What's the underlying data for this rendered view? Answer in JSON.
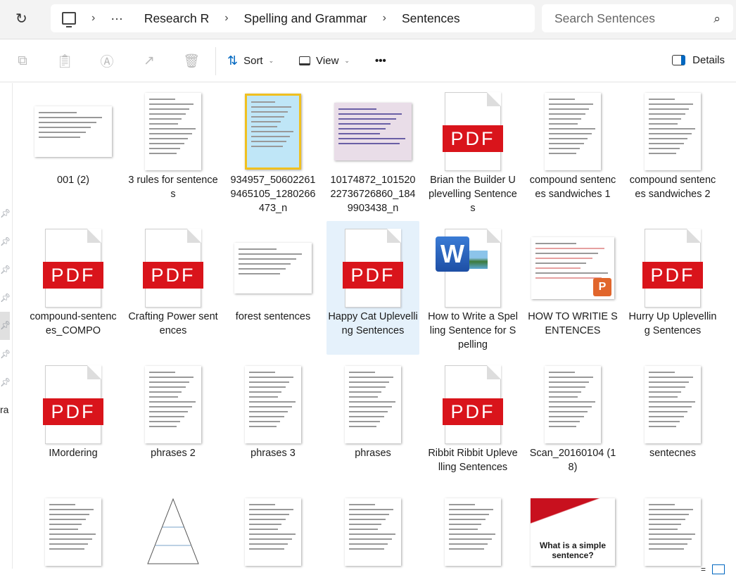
{
  "address": {
    "breadcrumb": [
      "Research R",
      "Spelling and Grammar",
      "Sentences"
    ],
    "search_placeholder": "Search Sentences"
  },
  "toolbar": {
    "sort": "Sort",
    "view": "View",
    "more": "•••",
    "details": "Details"
  },
  "sidebar": {
    "partial_label": "ra"
  },
  "items": [
    {
      "name": "001 (2)",
      "kind": "landscape"
    },
    {
      "name": "3 rules for sentences",
      "kind": "page"
    },
    {
      "name": "934957_506022619465105_1280266473_n",
      "kind": "poster"
    },
    {
      "name": "10174872_10152022736726860_1849903438_n",
      "kind": "chart"
    },
    {
      "name": "Brian the Builder Uplevelling Sentences",
      "kind": "pdf"
    },
    {
      "name": "compound sentences sandwiches 1",
      "kind": "page"
    },
    {
      "name": "compound sentences sandwiches 2",
      "kind": "page"
    },
    {
      "name": "compound-sentences_COMPO",
      "kind": "pdf"
    },
    {
      "name": "Crafting Power sentences",
      "kind": "pdf"
    },
    {
      "name": "forest sentences",
      "kind": "landscape"
    },
    {
      "name": "Happy Cat Uplevelling Sentences",
      "kind": "pdf",
      "selected": true
    },
    {
      "name": "How to Write a Spelling Sentence for Spelling",
      "kind": "word"
    },
    {
      "name": "HOW TO WRITIE SENTENCES",
      "kind": "ppt"
    },
    {
      "name": "Hurry Up Uplevelling Sentences",
      "kind": "pdf"
    },
    {
      "name": "IMordering",
      "kind": "pdf"
    },
    {
      "name": "phrases 2",
      "kind": "page"
    },
    {
      "name": "phrases 3",
      "kind": "page"
    },
    {
      "name": "phrases",
      "kind": "page"
    },
    {
      "name": "Ribbit Ribbit Uplevelling Sentences",
      "kind": "pdf"
    },
    {
      "name": "Scan_20160104 (18)",
      "kind": "page"
    },
    {
      "name": "sentecnes",
      "kind": "page"
    },
    {
      "name": "",
      "kind": "page"
    },
    {
      "name": "",
      "kind": "pyramid"
    },
    {
      "name": "",
      "kind": "page"
    },
    {
      "name": "",
      "kind": "page"
    },
    {
      "name": "",
      "kind": "page"
    },
    {
      "name": "",
      "kind": "slide",
      "caption": "What is a simple sentence?"
    },
    {
      "name": "",
      "kind": "page"
    }
  ],
  "pdf_label": "PDF",
  "colors": {
    "pdf_red": "#d9141b",
    "selection": "#e5f1fb",
    "accent": "#0067c0"
  }
}
